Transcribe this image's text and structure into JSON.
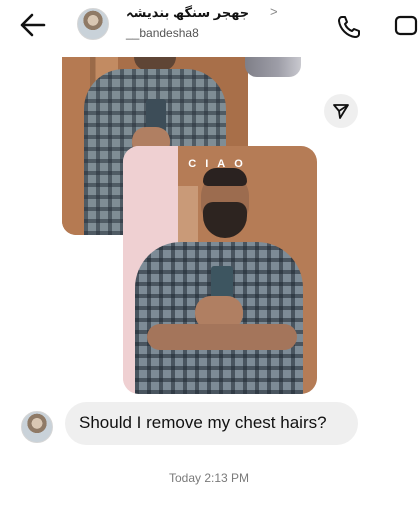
{
  "header": {
    "name": "جھجر سنگھ بندیشہ",
    "handle": "__bandesha8",
    "chevron": ">"
  },
  "media": {
    "caption": "CIAO"
  },
  "message": {
    "text": "Should I remove my chest hairs?",
    "timestamp": "Today 2:13 PM"
  }
}
